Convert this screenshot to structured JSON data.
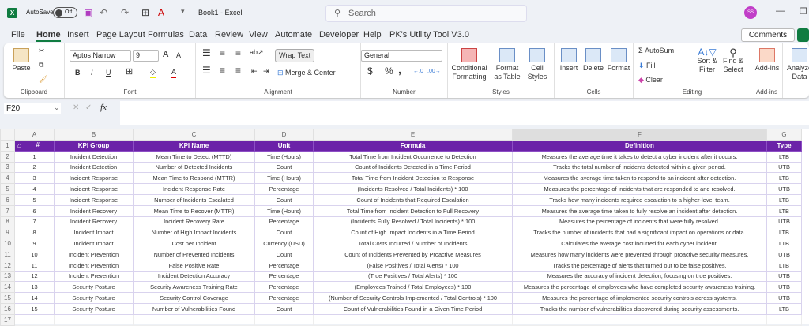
{
  "titlebar": {
    "autosave_label": "AutoSave",
    "autosave_state": "Off",
    "doc_title": "Book1  -  Excel",
    "search_placeholder": "Search",
    "avatar": "SS"
  },
  "tabs": [
    "File",
    "Home",
    "Insert",
    "Page Layout",
    "Formulas",
    "Data",
    "Review",
    "View",
    "Automate",
    "Developer",
    "Help",
    "PK's Utility Tool V3.0"
  ],
  "active_tab": "Home",
  "comments_label": "Comments",
  "ribbon": {
    "clipboard": {
      "label": "Clipboard",
      "paste": "Paste"
    },
    "font": {
      "label": "Font",
      "font_name": "Aptos Narrow",
      "font_size": "9",
      "bold": "B",
      "italic": "I",
      "underline": "U"
    },
    "alignment": {
      "label": "Alignment",
      "wrap_text": "Wrap Text",
      "merge_center": "Merge & Center"
    },
    "number": {
      "label": "Number",
      "format": "General",
      "currency": "$",
      "percent": "%",
      "comma": ","
    },
    "styles": {
      "label": "Styles",
      "conditional": "Conditional Formatting",
      "format_table": "Format as Table",
      "cell_styles": "Cell Styles"
    },
    "cells": {
      "label": "Cells",
      "insert": "Insert",
      "delete": "Delete",
      "format": "Format"
    },
    "editing": {
      "label": "Editing",
      "autosum": "AutoSum",
      "fill": "Fill",
      "clear": "Clear",
      "sort_filter": "Sort & Filter",
      "find_select": "Find & Select"
    },
    "addins": {
      "label": "Add-ins",
      "addins": "Add-ins",
      "analyze": "Analyze Data"
    }
  },
  "formula_bar": {
    "name_box": "F20",
    "fx": "fx",
    "value": ""
  },
  "sheet": {
    "columns": [
      "A",
      "B",
      "C",
      "D",
      "E",
      "F",
      "G"
    ],
    "selected_column": "F",
    "headers": [
      "#",
      "KPI Group",
      "KPI Name",
      "Unit",
      "Formula",
      "Definition",
      "Type"
    ],
    "rows": [
      [
        "1",
        "Incident Detection",
        "Mean Time to Detect (MTTD)",
        "Time (Hours)",
        "Total Time from Incident Occurrence to Detection",
        "Measures the average time it takes to detect a cyber incident after it occurs.",
        "LTB"
      ],
      [
        "2",
        "Incident Detection",
        "Number of Detected Incidents",
        "Count",
        "Count of Incidents Detected in a Time Period",
        "Tracks the total number of incidents detected within a given period.",
        "UTB"
      ],
      [
        "3",
        "Incident Response",
        "Mean Time to Respond (MTTR)",
        "Time (Hours)",
        "Total Time from Incident Detection to Response",
        "Measures the average time taken to respond to an incident after detection.",
        "LTB"
      ],
      [
        "4",
        "Incident Response",
        "Incident Response Rate",
        "Percentage",
        "(Incidents Resolved / Total Incidents) * 100",
        "Measures the percentage of incidents that are responded to and resolved.",
        "UTB"
      ],
      [
        "5",
        "Incident Response",
        "Number of Incidents Escalated",
        "Count",
        "Count of Incidents that Required Escalation",
        "Tracks how many incidents required escalation to a higher-level team.",
        "LTB"
      ],
      [
        "6",
        "Incident Recovery",
        "Mean Time to Recover (MTTR)",
        "Time (Hours)",
        "Total Time from Incident Detection to Full Recovery",
        "Measures the average time taken to fully resolve an incident after detection.",
        "LTB"
      ],
      [
        "7",
        "Incident Recovery",
        "Incident Recovery Rate",
        "Percentage",
        "(Incidents Fully Resolved / Total Incidents) * 100",
        "Measures the percentage of incidents that were fully resolved.",
        "UTB"
      ],
      [
        "8",
        "Incident Impact",
        "Number of High Impact Incidents",
        "Count",
        "Count of High Impact Incidents in a Time Period",
        "Tracks the number of incidents that had a significant impact on operations or data.",
        "LTB"
      ],
      [
        "9",
        "Incident Impact",
        "Cost per Incident",
        "Currency (USD)",
        "Total Costs Incurred / Number of Incidents",
        "Calculates the average cost incurred for each cyber incident.",
        "LTB"
      ],
      [
        "10",
        "Incident Prevention",
        "Number of Prevented Incidents",
        "Count",
        "Count of Incidents Prevented by Proactive Measures",
        "Measures how many incidents were prevented through proactive security measures.",
        "UTB"
      ],
      [
        "11",
        "Incident Prevention",
        "False Positive Rate",
        "Percentage",
        "(False Positives / Total Alerts) * 100",
        "Tracks the percentage of alerts that turned out to be false positives.",
        "LTB"
      ],
      [
        "12",
        "Incident Prevention",
        "Incident Detection Accuracy",
        "Percentage",
        "(True Positives / Total Alerts) * 100",
        "Measures the accuracy of incident detection, focusing on true positives.",
        "UTB"
      ],
      [
        "13",
        "Security Posture",
        "Security Awareness Training Rate",
        "Percentage",
        "(Employees Trained / Total Employees) * 100",
        "Measures the percentage of employees who have completed security awareness training.",
        "UTB"
      ],
      [
        "14",
        "Security Posture",
        "Security Control Coverage",
        "Percentage",
        "(Number of Security Controls Implemented / Total Controls) * 100",
        "Measures the percentage of implemented security controls across systems.",
        "UTB"
      ],
      [
        "15",
        "Security Posture",
        "Number of Vulnerabilities Found",
        "Count",
        "Count of Vulnerabilities Found in a Given Time Period",
        "Tracks the number of vulnerabilities discovered during security assessments.",
        "LTB"
      ]
    ]
  },
  "colors": {
    "header_bg": "#6b22a8",
    "accent": "#107c41"
  }
}
